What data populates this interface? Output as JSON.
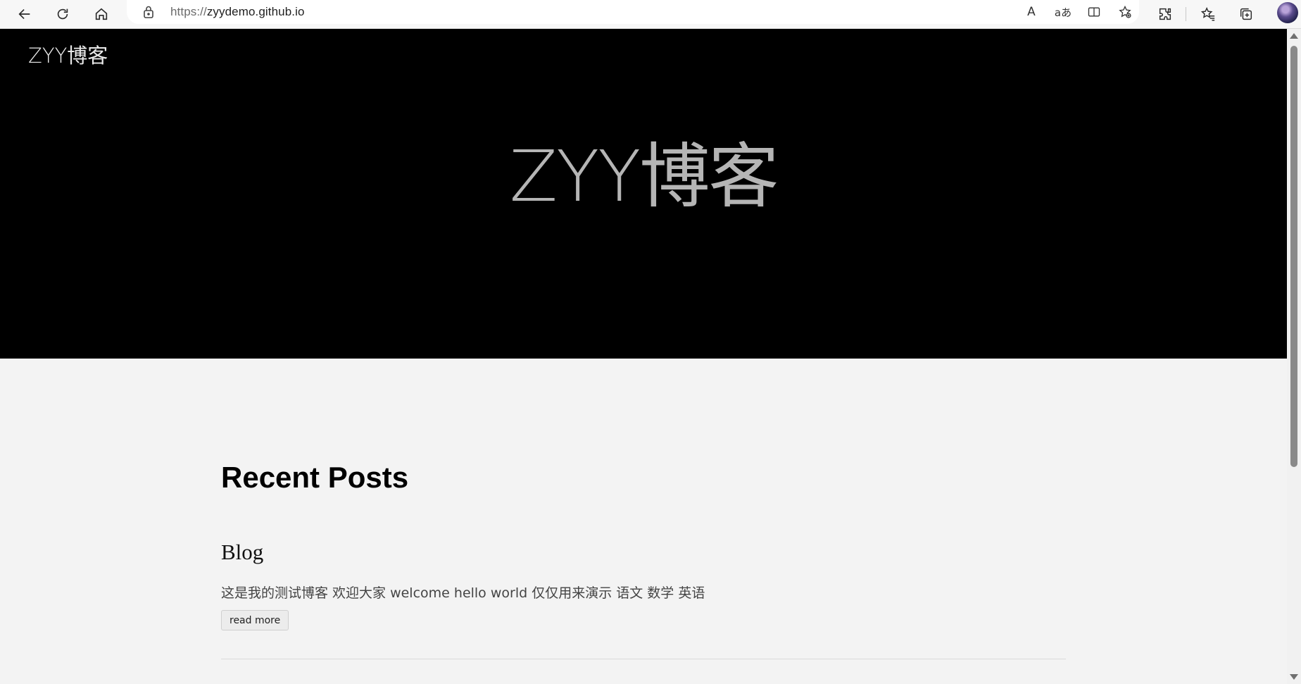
{
  "browser": {
    "url_scheme": "https://",
    "url_host": "zyydemo.github.io",
    "icons": {
      "back": "back-arrow-icon",
      "refresh": "refresh-icon",
      "home": "home-icon",
      "lock": "lock-icon",
      "read_aloud": "read-aloud-icon",
      "translate": "translate-icon",
      "split_screen": "split-screen-icon",
      "favorite_add": "add-favorite-icon",
      "extensions": "extensions-icon",
      "favorites": "favorites-icon",
      "collections": "collections-icon",
      "profile": "profile-avatar"
    },
    "read_aloud_glyph": "A",
    "translate_glyph": "aあ"
  },
  "site": {
    "logo": "ZYY博客",
    "hero_title": "ZYY博客",
    "hero_background": "#000000",
    "page_background": "#f3f3f3"
  },
  "main": {
    "section_title": "Recent Posts",
    "posts": [
      {
        "title": "Blog",
        "excerpt": "这是我的测试博客 欢迎大家 welcome hello world 仅仅用来演示 语文 数学 英语",
        "read_more_label": "read more"
      }
    ]
  }
}
